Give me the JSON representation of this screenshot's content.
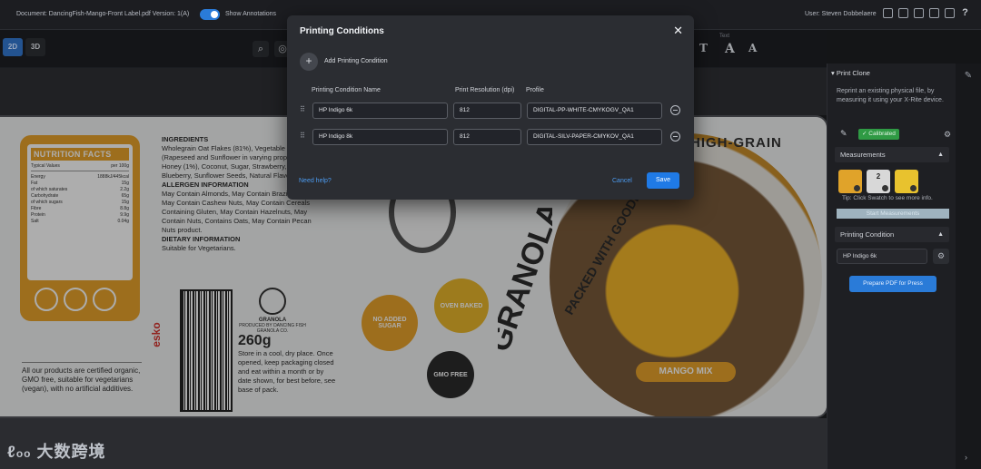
{
  "topbar": {
    "document": "Document: DancingFish-Mango-Front Label.pdf Version: 1(A)",
    "show_annotations": "Show Annotations",
    "user": "User: Steven Dobbelaere"
  },
  "toolbar": {
    "view_2d": "2D",
    "view_3d": "3D",
    "text_group_label": "Text"
  },
  "label": {
    "nutrition_title": "NUTRITION FACTS",
    "typical_values": "Typical Values",
    "per_100g": "per 100g",
    "nutrition_rows": [
      {
        "name": "Energy",
        "value": "1888kJ/445kcal"
      },
      {
        "name": "Fat",
        "value": "15g"
      },
      {
        "name": "of which saturates",
        "value": "2.2g"
      },
      {
        "name": "Carbohydrate",
        "value": "65g"
      },
      {
        "name": "of which sugars",
        "value": "15g"
      },
      {
        "name": "Fibre",
        "value": "8.8g"
      },
      {
        "name": "Protein",
        "value": "9.9g"
      },
      {
        "name": "Salt",
        "value": "0.04g"
      }
    ],
    "ingredients_title": "INGREDIENTS",
    "ingredients_text": "Wholegrain Oat Flakes (81%), Vegetable Oil (Rapeseed and Sunflower in varying proportions), Honey (1%), Coconut, Sugar, Strawberry, Blueberry, Sunflower Seeds, Natural Flavoring.",
    "allergen_title": "ALLERGEN INFORMATION",
    "allergen_text": "May Contain Almonds, May Contain Brazil Nuts, May Contain Cashew Nuts, May Contain Cereals Containing Gluten, May Contain Hazelnuts, May Contain Nuts, Contains Oats, May Contain Pecan Nuts product.",
    "dietary_title": "DIETARY INFORMATION",
    "dietary_text": "Suitable for Vegetarians.",
    "certified_text": "All our products are certified organic, GMO free, suitable for vegetarians (vegan), with no artificial additives.",
    "brand_name": "GRANOLA",
    "produced_by": "PRODUCED BY DANCING FISH GRANOLA CO.",
    "weight": "260g",
    "storage_text": "Store in a cool, dry place. Once opened, keep packaging closed and eat within a month or by date shown, for best before, see base of pack.",
    "no_added_sugar": "NO ADDED SUGAR",
    "oven_baked": "OVEN BAKED",
    "gmo_free": "GMO FREE",
    "high_grain": "HIGH-GRAIN",
    "packed": "PACKED WITH GOODNESS",
    "granola_vertical": "GRANOLA",
    "mango_mix": "MANGO MIX",
    "esko": "esko"
  },
  "modal": {
    "title": "Printing Conditions",
    "add_label": "Add Printing Condition",
    "col_name": "Printing Condition Name",
    "col_resolution": "Print Resolution (dpi)",
    "col_profile": "Profile",
    "rows": [
      {
        "name": "HP Indigo 6k",
        "resolution": "812",
        "profile": "DIGITAL-PP-WHITE-CMYKOGV_QA1"
      },
      {
        "name": "HP Indigo 8k",
        "resolution": "812",
        "profile": "DIGITAL-SILV-PAPER-CMYKOV_QA1"
      }
    ],
    "need_help": "Need help?",
    "cancel": "Cancel",
    "save": "Save"
  },
  "right_panel": {
    "print_clone_title": "Print Clone",
    "description": "Reprint an existing physical file, by measuring it using your X-Rite device.",
    "calibrated": "Calibrated",
    "measurements_title": "Measurements",
    "swatch_colors": [
      "#e0a32a",
      "#d8d8d8",
      "#e8c22e"
    ],
    "swatch_2_label": "2",
    "tip": "Tip: Click Swatch to see more info.",
    "start_measurements": "Start Measurements",
    "printing_condition_title": "Printing Condition",
    "printing_condition_value": "HP Indigo 6k",
    "prepare_button": "Prepare PDF for Press"
  },
  "watermark": "大数跨境"
}
